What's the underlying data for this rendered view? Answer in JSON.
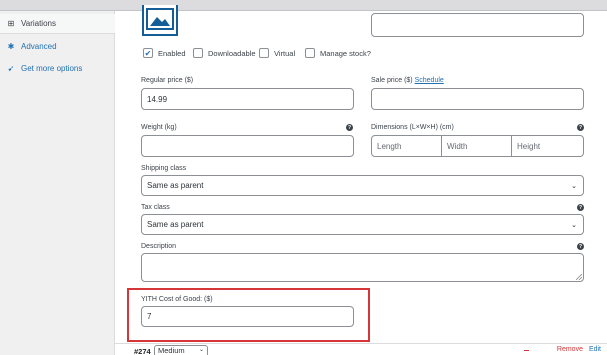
{
  "sidebar": {
    "items": [
      {
        "label": "Variations",
        "icon": "grid-icon"
      },
      {
        "label": "Advanced",
        "icon": "gear-icon"
      },
      {
        "label": "Get more options",
        "icon": "plug-icon"
      }
    ]
  },
  "options": {
    "enabled_label": "Enabled",
    "enabled_checked": true,
    "downloadable_label": "Downloadable",
    "downloadable_checked": false,
    "virtual_label": "Virtual",
    "virtual_checked": false,
    "manage_stock_label": "Manage stock?",
    "manage_stock_checked": false
  },
  "pricing": {
    "regular_label": "Regular price ($)",
    "regular_value": "14.99",
    "sale_label": "Sale price ($)",
    "schedule_link": "Schedule",
    "sale_value": ""
  },
  "shipping": {
    "weight_label": "Weight (kg)",
    "weight_value": "",
    "dimensions_label": "Dimensions (L×W×H) (cm)",
    "length_placeholder": "Length",
    "width_placeholder": "Width",
    "height_placeholder": "Height",
    "shipping_class_label": "Shipping class",
    "shipping_class_value": "Same as parent"
  },
  "tax": {
    "label": "Tax class",
    "value": "Same as parent"
  },
  "description": {
    "label": "Description",
    "value": ""
  },
  "cost_of_good": {
    "label": "YITH Cost of Good: ($)",
    "value": "7"
  },
  "variation_row": {
    "id": "#274",
    "attribute_value": "Medium",
    "remove_label": "Remove",
    "edit_label": "Edit"
  },
  "colors": {
    "accent": "#2271b1",
    "highlight": "#d63638"
  }
}
